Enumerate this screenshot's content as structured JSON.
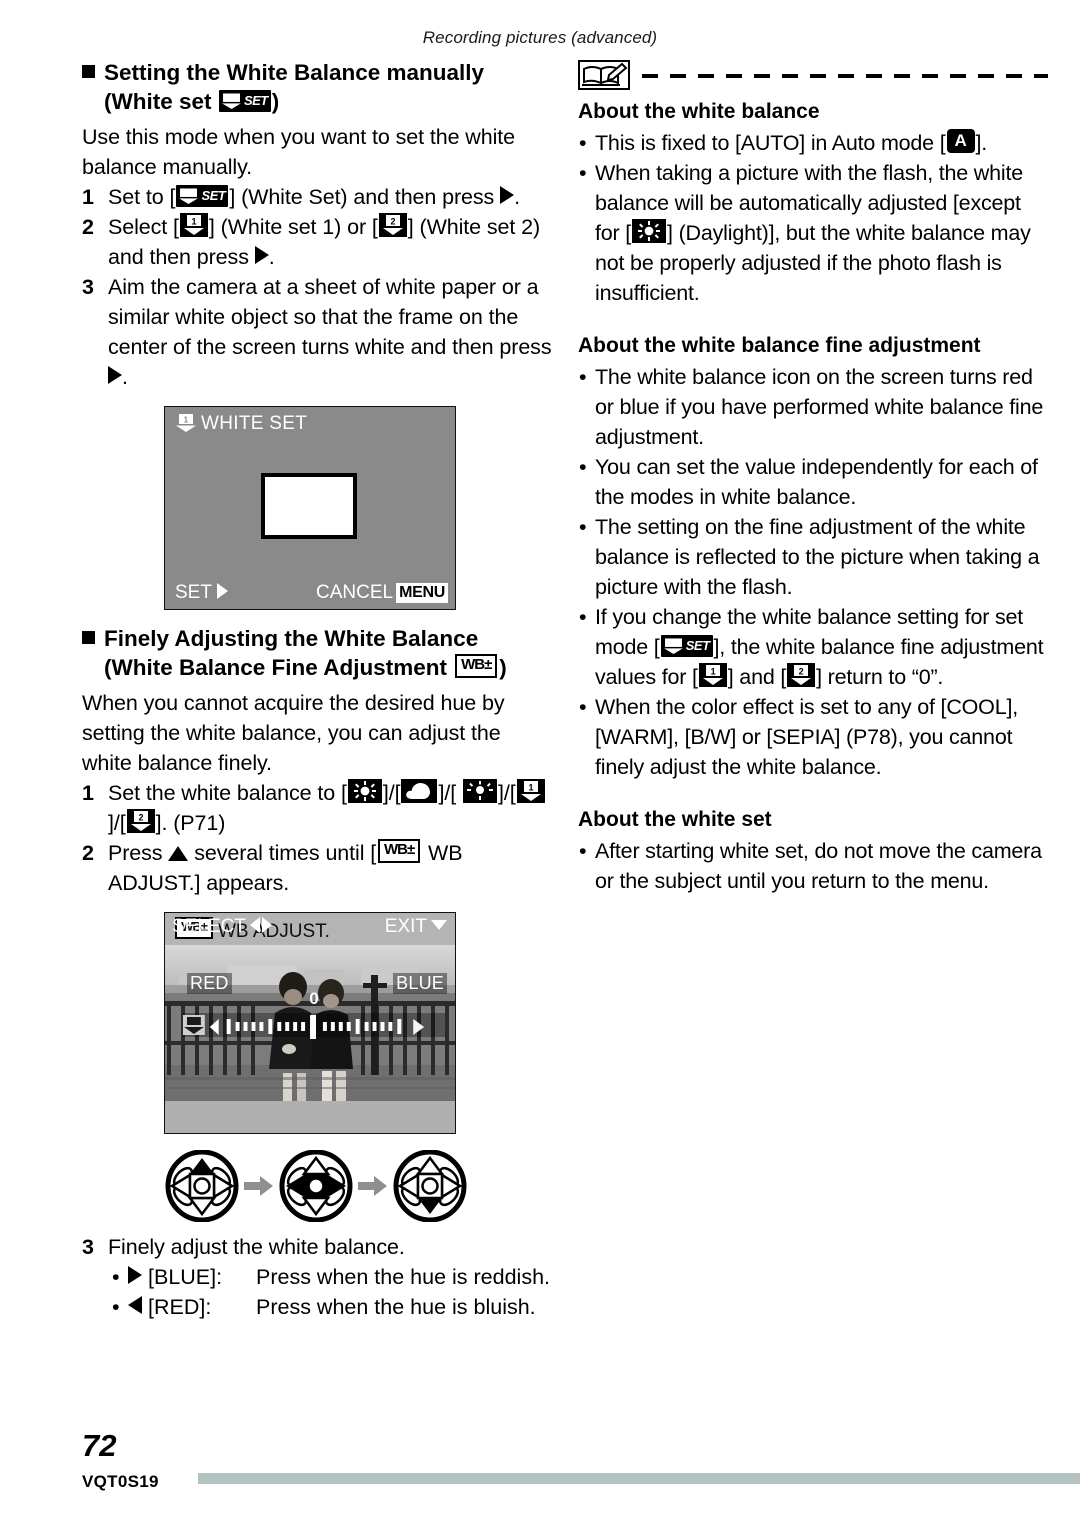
{
  "page": {
    "running_head": "Recording pictures (advanced)",
    "number": "72",
    "doc_code": "VQT0S19",
    "footer_bar_color": "#b5c2c2"
  },
  "left_column": {
    "heading1": {
      "line1": "Setting the White Balance manually",
      "line2_prefix": "(White set ",
      "line2_suffix": ")"
    },
    "intro": "Use this mode when you want to set the white balance manually.",
    "steps": [
      {
        "num": "1",
        "text_a": "Set to [",
        "text_b": "] (White Set) and then press ",
        "text_c": "."
      },
      {
        "num": "2",
        "text_a": "Select [",
        "text_b": "] (White set 1) or [",
        "text_c": "] (White set 2) and then press ",
        "text_d": "."
      },
      {
        "num": "3",
        "text_a": "Aim the camera at a sheet of white paper or a similar white object so that the frame on the center of the screen turns white and then press ",
        "text_b": "."
      }
    ],
    "white_set_screen": {
      "title": "WHITE SET",
      "set_label": "SET",
      "cancel_label": "CANCEL",
      "menu_label": "MENU",
      "background_color": "#8a8a8a"
    },
    "heading2": {
      "line1": "Finely Adjusting the White Balance",
      "line2_prefix": "(White Balance Fine Adjustment ",
      "line2_suffix": ")"
    },
    "intro2": "When you cannot acquire the desired hue by setting the white balance, you can adjust the white balance finely.",
    "steps2": [
      {
        "num": "1",
        "text_a": "Set the white balance to [",
        "text_b": "]/[",
        "text_c": "]/[",
        "text_d": "]/[",
        "text_e": "]/[",
        "text_f": "]. (P71)"
      },
      {
        "num": "2",
        "text_a": "Press ",
        "text_b": " several times until [",
        "text_c": " WB ADJUST.] appears."
      }
    ],
    "wb_adjust_screen": {
      "title": "WB ADJUST.",
      "red_label": "RED",
      "blue_label": "BLUE",
      "zero_value": "0",
      "select_label": "SELECT",
      "exit_label": "EXIT"
    },
    "step3": {
      "num": "3",
      "text": "Finely adjust the white balance.",
      "sub": [
        {
          "dir": "right",
          "label": "[BLUE]:",
          "text": "Press when the hue is reddish."
        },
        {
          "dir": "left",
          "label": "[RED]:",
          "text": "Press when the hue is bluish."
        }
      ]
    }
  },
  "right_column": {
    "note_icon": "book-pencil-icon",
    "section1": {
      "heading": "About the white balance",
      "bullets": [
        {
          "a": "This is fixed to [AUTO] in Auto mode [",
          "b": "]."
        },
        {
          "a": "When taking a picture with the flash, the white balance will be automatically adjusted [except for [",
          "b": "] (Daylight)], but the white balance may not be properly adjusted if the photo flash is insufficient."
        }
      ]
    },
    "section2": {
      "heading": "About the white balance fine adjustment",
      "bullets": [
        {
          "a": "The white balance icon on the screen turns red or blue if you have performed white balance fine adjustment."
        },
        {
          "a": "You can set the value independently for each of the modes in white balance."
        },
        {
          "a": "The setting on the fine adjustment of the white balance is reflected to the picture when taking a picture with the flash."
        },
        {
          "a": "If you change the white balance setting for set mode [",
          "b": "], the white balance fine adjustment values for [",
          "c": "] and [",
          "d": "] return to “0”."
        },
        {
          "a": "When the color effect is set to any of [COOL], [WARM], [B/W] or [SEPIA] (P78), you cannot finely adjust the white balance."
        }
      ]
    },
    "section3": {
      "heading": "About the white set",
      "bullets": [
        {
          "a": "After starting white set, do not move the camera or the subject until you return to the menu."
        }
      ]
    }
  }
}
